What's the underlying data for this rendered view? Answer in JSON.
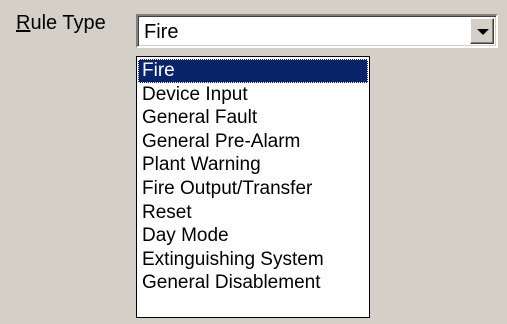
{
  "rule_type": {
    "label_mnemonic": "R",
    "label_rest": "ule Type",
    "selected_value": "Fire",
    "options": [
      "Fire",
      "Device Input",
      "General Fault",
      "General Pre-Alarm",
      "Plant Warning",
      "Fire Output/Transfer",
      "Reset",
      "Day Mode",
      "Extinguishing System",
      "General Disablement"
    ],
    "highlighted_index": 0
  },
  "colors": {
    "dialog_background": "#d4d0c8",
    "highlight_background": "#0a246a",
    "highlight_text": "#ffffff"
  },
  "icons": {
    "dropdown_button": "chevron-down-icon"
  }
}
